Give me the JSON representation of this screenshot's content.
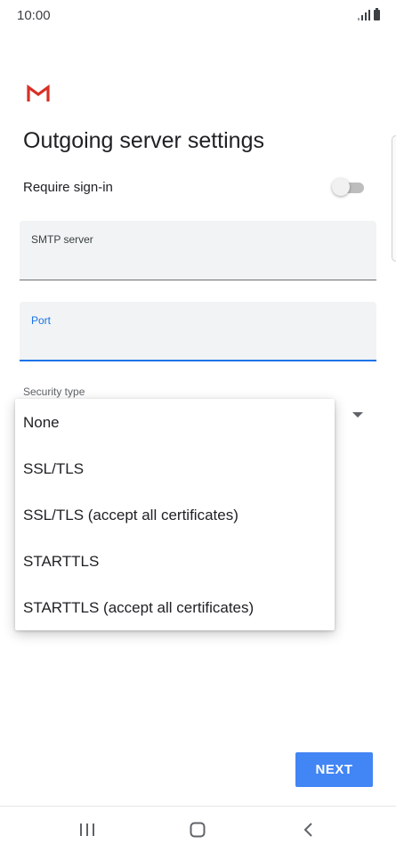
{
  "status_bar": {
    "time": "10:00",
    "icons": [
      "signal-icon",
      "battery-icon"
    ]
  },
  "app": {
    "logo": "gmail-logo-icon",
    "accent_color": "#1a73e8",
    "button_color": "#4285f4"
  },
  "page": {
    "title": "Outgoing server settings"
  },
  "signin": {
    "label": "Require sign-in",
    "enabled": false
  },
  "smtp_field": {
    "label": "SMTP server",
    "value": ""
  },
  "port_field": {
    "label": "Port",
    "value": ""
  },
  "security": {
    "label": "Security type",
    "options": [
      "None",
      "SSL/TLS",
      "SSL/TLS (accept all certificates)",
      "STARTTLS",
      "STARTTLS (accept all certificates)"
    ]
  },
  "footer": {
    "next_label": "NEXT"
  },
  "nav_bar": {
    "icons": [
      "recent-apps-icon",
      "home-icon",
      "back-icon"
    ]
  }
}
